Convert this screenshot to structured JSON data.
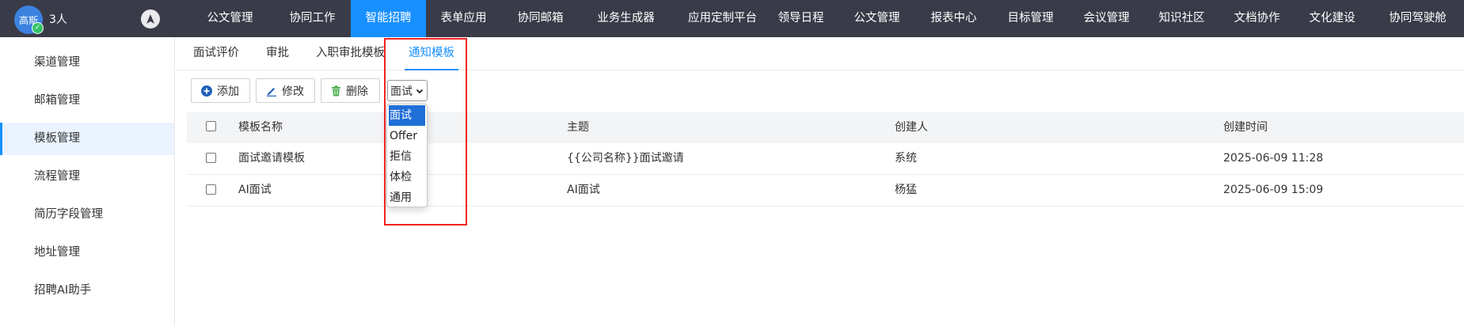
{
  "user": {
    "avatar_text": "高斯",
    "count_label": "3人"
  },
  "nav": {
    "items": [
      {
        "label": "公文管理"
      },
      {
        "label": "协同工作"
      },
      {
        "label": "智能招聘"
      },
      {
        "label": "表单应用"
      },
      {
        "label": "协同邮箱"
      },
      {
        "label": "业务生成器"
      },
      {
        "label": "应用定制平台"
      },
      {
        "label": "领导日程"
      },
      {
        "label": "公文管理"
      },
      {
        "label": "报表中心"
      },
      {
        "label": "目标管理"
      },
      {
        "label": "会议管理"
      },
      {
        "label": "知识社区"
      },
      {
        "label": "文档协作"
      },
      {
        "label": "文化建设"
      },
      {
        "label": "协同驾驶舱"
      }
    ],
    "active_index": 2
  },
  "sidebar": {
    "items": [
      {
        "label": "渠道管理"
      },
      {
        "label": "邮箱管理"
      },
      {
        "label": "模板管理"
      },
      {
        "label": "流程管理"
      },
      {
        "label": "简历字段管理"
      },
      {
        "label": "地址管理"
      },
      {
        "label": "招聘AI助手"
      }
    ],
    "active_index": 2
  },
  "tabs": {
    "items": [
      {
        "label": "面试评价"
      },
      {
        "label": "审批"
      },
      {
        "label": "入职审批模板"
      },
      {
        "label": "通知模板"
      }
    ],
    "active_index": 3
  },
  "toolbar": {
    "add_label": "添加",
    "edit_label": "修改",
    "delete_label": "删除",
    "select_value": "面试"
  },
  "table": {
    "columns": [
      "模板名称",
      "主题",
      "创建人",
      "创建时间"
    ],
    "rows": [
      {
        "name": "面试邀请模板",
        "subject": "{{公司名称}}面试邀请",
        "creator": "系统",
        "created": "2025-06-09 11:28"
      },
      {
        "name": "AI面试",
        "subject": "AI面试",
        "creator": "杨猛",
        "created": "2025-06-09 15:09"
      }
    ]
  },
  "dropdown": {
    "options": [
      "面试",
      "Offer",
      "拒信",
      "体检",
      "通用"
    ],
    "selected_index": 0
  },
  "colors": {
    "accent": "#1890ff",
    "topbar": "#3a3b48",
    "highlight": "#ef2424"
  }
}
